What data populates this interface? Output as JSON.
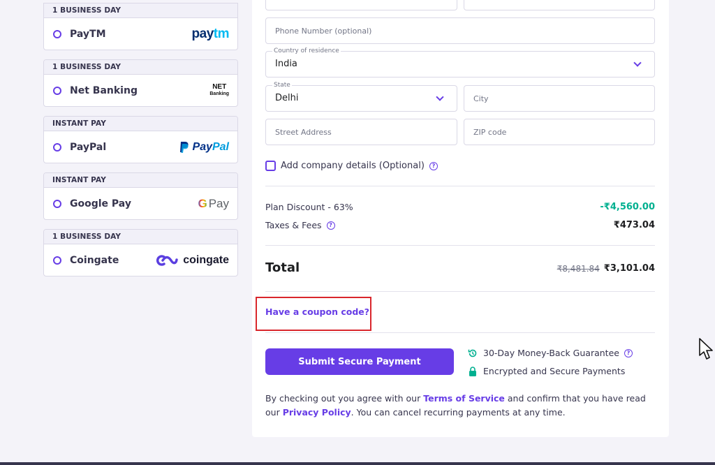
{
  "payment_methods": [
    {
      "tag": "1 BUSINESS DAY",
      "name": "PayTM",
      "logo": "paytm-logo",
      "logo_text_a": "pay",
      "logo_text_b": "tm"
    },
    {
      "tag": "1 BUSINESS DAY",
      "name": "Net Banking",
      "logo": "net-banking-logo",
      "logo_text_a": "NET",
      "logo_text_b": "Banking"
    },
    {
      "tag": "INSTANT PAY",
      "name": "PayPal",
      "logo": "paypal-logo",
      "logo_text_a": "Pay",
      "logo_text_b": "Pal"
    },
    {
      "tag": "INSTANT PAY",
      "name": "Google Pay",
      "logo": "google-pay-logo",
      "logo_text_a": "G",
      "logo_text_b": "Pay"
    },
    {
      "tag": "1 BUSINESS DAY",
      "name": "Coingate",
      "logo": "coingate-logo",
      "logo_text_a": "coingate",
      "logo_text_b": ""
    }
  ],
  "form": {
    "phone_placeholder": "Phone Number (optional)",
    "country_label": "Country of residence",
    "country_value": "India",
    "state_label": "State",
    "state_value": "Delhi",
    "city_placeholder": "City",
    "street_placeholder": "Street Address",
    "zip_placeholder": "ZIP code",
    "company_checkbox_label": "Add company details (Optional)"
  },
  "summary": {
    "discount_label": "Plan Discount - 63%",
    "discount_value": "-₹4,560.00",
    "taxes_label": "Taxes & Fees",
    "taxes_value": "₹473.04",
    "total_label": "Total",
    "total_old": "₹8,481.84",
    "total_new": "₹3,101.04"
  },
  "coupon_link": "Have a coupon code?",
  "submit_label": "Submit Secure Payment",
  "guarantees": [
    "30-Day Money-Back Guarantee",
    "Encrypted and Secure Payments"
  ],
  "terms": {
    "part1": "By checking out you agree with our ",
    "tos": "Terms of Service",
    "part2": " and confirm that you have read our ",
    "privacy": "Privacy Policy",
    "part3": ". You can cancel recurring payments at any time."
  },
  "colors": {
    "accent": "#673de6",
    "discount": "#00b090",
    "highlight": "#d9262c"
  }
}
